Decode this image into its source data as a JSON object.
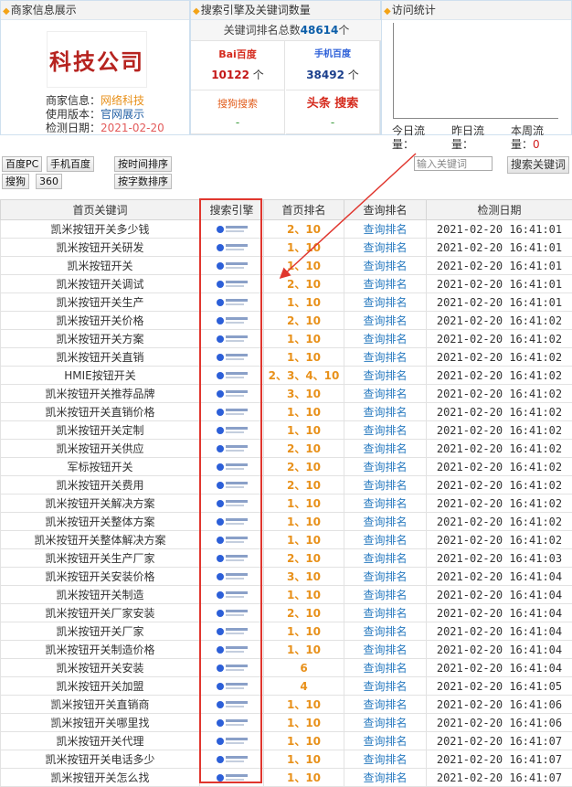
{
  "panels": {
    "merchant_title": "商家信息展示",
    "search_title": "搜索引擎及关键词数量",
    "visits_title": "访问统计"
  },
  "merchant": {
    "logo_text": "科技公司",
    "info_label": "商家信息：",
    "info_value": "网络科技",
    "version_label": "使用版本：",
    "version_value": "官网展示",
    "date_label": "检测日期：",
    "date_value": "2021-02-20"
  },
  "keywords_total": {
    "label": "关键词排名总数",
    "value": "48614",
    "unit": "个"
  },
  "engines": [
    {
      "name": "Bai百度",
      "count": "10122",
      "unit": "个"
    },
    {
      "name": "手机百度",
      "count": "38492",
      "unit": "个"
    },
    {
      "name": "搜狗搜索",
      "count": "-",
      "unit": ""
    },
    {
      "name": "头条 搜索",
      "count": "-",
      "unit": ""
    }
  ],
  "visits": {
    "today_label": "今日流量：",
    "today_value": "",
    "yesterday_label": "昨日流量：",
    "yesterday_value": "",
    "week_label": "本周流量：",
    "week_value": "0"
  },
  "filters": {
    "baidu_pc": "百度PC",
    "mobile_baidu": "手机百度",
    "sort_time": "按时间排序",
    "sogou": "搜狗",
    "s360": "360",
    "sort_count": "按字数排序",
    "search_placeholder": "输入关键词",
    "search_button": "搜索关键词"
  },
  "table": {
    "headers": [
      "首页关键词",
      "搜索引擎",
      "首页排名",
      "查询排名",
      "检测日期"
    ],
    "query_label": "查询排名",
    "rows": [
      {
        "kw": "凯米按钮开关多少钱",
        "rank": "2、10",
        "date": "2021-02-20 16:41:01"
      },
      {
        "kw": "凯米按钮开关研发",
        "rank": "1、10",
        "date": "2021-02-20 16:41:01"
      },
      {
        "kw": "凯米按钮开关",
        "rank": "1、10",
        "date": "2021-02-20 16:41:01"
      },
      {
        "kw": "凯米按钮开关调试",
        "rank": "2、10",
        "date": "2021-02-20 16:41:01"
      },
      {
        "kw": "凯米按钮开关生产",
        "rank": "1、10",
        "date": "2021-02-20 16:41:01"
      },
      {
        "kw": "凯米按钮开关价格",
        "rank": "2、10",
        "date": "2021-02-20 16:41:02"
      },
      {
        "kw": "凯米按钮开关方案",
        "rank": "1、10",
        "date": "2021-02-20 16:41:02"
      },
      {
        "kw": "凯米按钮开关直销",
        "rank": "1、10",
        "date": "2021-02-20 16:41:02"
      },
      {
        "kw": "HMIE按钮开关",
        "rank": "2、3、4、10",
        "date": "2021-02-20 16:41:02"
      },
      {
        "kw": "凯米按钮开关推荐品牌",
        "rank": "3、10",
        "date": "2021-02-20 16:41:02"
      },
      {
        "kw": "凯米按钮开关直销价格",
        "rank": "1、10",
        "date": "2021-02-20 16:41:02"
      },
      {
        "kw": "凯米按钮开关定制",
        "rank": "1、10",
        "date": "2021-02-20 16:41:02"
      },
      {
        "kw": "凯米按钮开关供应",
        "rank": "2、10",
        "date": "2021-02-20 16:41:02"
      },
      {
        "kw": "军标按钮开关",
        "rank": "2、10",
        "date": "2021-02-20 16:41:02"
      },
      {
        "kw": "凯米按钮开关费用",
        "rank": "2、10",
        "date": "2021-02-20 16:41:02"
      },
      {
        "kw": "凯米按钮开关解决方案",
        "rank": "1、10",
        "date": "2021-02-20 16:41:02"
      },
      {
        "kw": "凯米按钮开关整体方案",
        "rank": "1、10",
        "date": "2021-02-20 16:41:02"
      },
      {
        "kw": "凯米按钮开关整体解决方案",
        "rank": "1、10",
        "date": "2021-02-20 16:41:02"
      },
      {
        "kw": "凯米按钮开关生产厂家",
        "rank": "2、10",
        "date": "2021-02-20 16:41:03"
      },
      {
        "kw": "凯米按钮开关安装价格",
        "rank": "3、10",
        "date": "2021-02-20 16:41:04"
      },
      {
        "kw": "凯米按钮开关制造",
        "rank": "1、10",
        "date": "2021-02-20 16:41:04"
      },
      {
        "kw": "凯米按钮开关厂家安装",
        "rank": "2、10",
        "date": "2021-02-20 16:41:04"
      },
      {
        "kw": "凯米按钮开关厂家",
        "rank": "1、10",
        "date": "2021-02-20 16:41:04"
      },
      {
        "kw": "凯米按钮开关制造价格",
        "rank": "1、10",
        "date": "2021-02-20 16:41:04"
      },
      {
        "kw": "凯米按钮开关安装",
        "rank": "6",
        "date": "2021-02-20 16:41:04"
      },
      {
        "kw": "凯米按钮开关加盟",
        "rank": "4",
        "date": "2021-02-20 16:41:05"
      },
      {
        "kw": "凯米按钮开关直销商",
        "rank": "1、10",
        "date": "2021-02-20 16:41:06"
      },
      {
        "kw": "凯米按钮开关哪里找",
        "rank": "1、10",
        "date": "2021-02-20 16:41:06"
      },
      {
        "kw": "凯米按钮开关代理",
        "rank": "1、10",
        "date": "2021-02-20 16:41:07"
      },
      {
        "kw": "凯米按钮开关电话多少",
        "rank": "1、10",
        "date": "2021-02-20 16:41:07"
      },
      {
        "kw": "凯米按钮开关怎么找",
        "rank": "1、10",
        "date": "2021-02-20 16:41:07"
      }
    ]
  },
  "colors": {
    "accent_orange": "#e8911b",
    "link_blue": "#2a7bc0",
    "highlight_red": "#e0362e"
  }
}
